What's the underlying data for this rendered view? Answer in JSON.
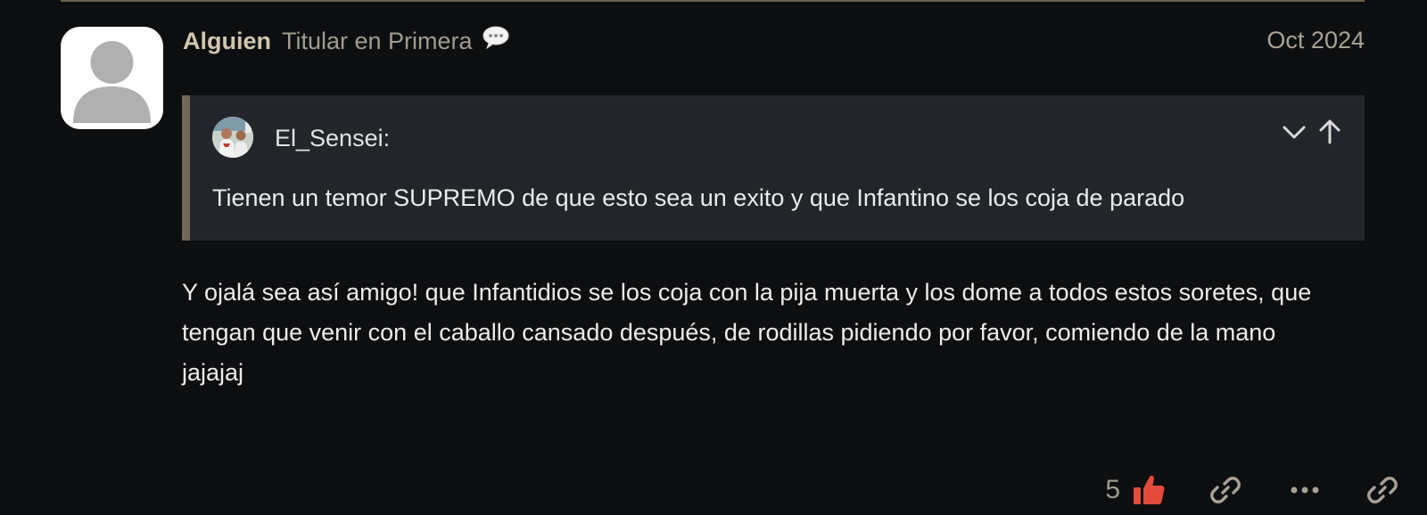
{
  "post": {
    "username": "Alguien",
    "user_title": "Titular en Primera",
    "date": "Oct 2024",
    "avatar_icon": "default-user-icon",
    "user_title_icon": "speech-bubble-icon"
  },
  "quote": {
    "author": "El_Sensei:",
    "text": "Tienen un temor SUPREMO de que esto sea un exito y que Infantino se los coja de parado",
    "controls": [
      "chevron-down-icon",
      "arrow-up-icon"
    ]
  },
  "body": {
    "paragraphs": [
      "Y ojalá sea así amigo! que Infantidios se los coja con la pija muerta y los dome a todos estos soretes, que tengan que venir con el caballo cansado después, de rodillas pidiendo por favor, comiendo de la mano jajajaj"
    ]
  },
  "actions": {
    "like_count": "5",
    "icons": [
      "thumbs-up-icon",
      "link-icon",
      "more-icon",
      "reply-link-icon"
    ]
  },
  "colors": {
    "background": "#0d0e10",
    "username": "#cfc6ad",
    "muted": "#a19c91",
    "quote_bg": "#22262a",
    "quote_border": "#6f675a",
    "like_accent": "#e24a3b"
  }
}
